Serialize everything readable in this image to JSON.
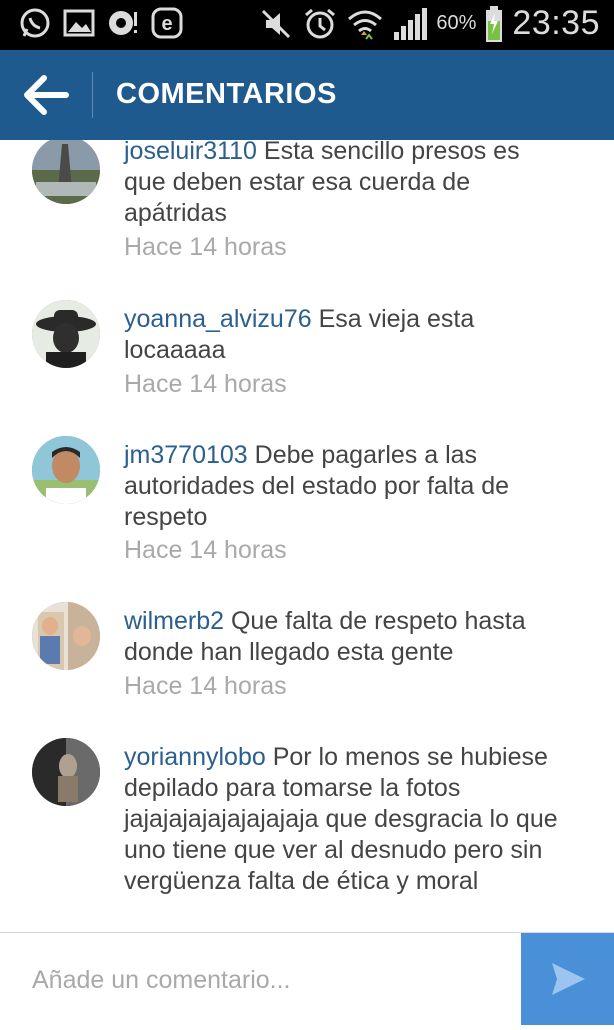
{
  "status_bar": {
    "battery": "60%",
    "time": "23:35",
    "left_icons": [
      "whatsapp-icon",
      "gallery-icon",
      "chat-icon",
      "e-app-icon"
    ],
    "right_icons": [
      "mute-icon",
      "alarm-icon",
      "wifi-icon",
      "signal-icon",
      "battery-icon"
    ]
  },
  "header": {
    "title": "COMENTARIOS",
    "back_icon": "arrow-left-icon",
    "bg_color": "#1e5a8e"
  },
  "comments": [
    {
      "username": "joseluir3110",
      "text": " Esta sencillo presos es que deben estar esa cuerda de apátridas",
      "time": "Hace 14 horas"
    },
    {
      "username": "yoanna_alvizu76",
      "text": " Esa vieja esta locaaaaa",
      "time": "Hace 14 horas"
    },
    {
      "username": "jm3770103",
      "text": " Debe pagarles a las autoridades del estado por falta de respeto",
      "time": "Hace 14 horas"
    },
    {
      "username": "wilmerb2",
      "text": " Que falta de respeto hasta donde han llegado esta gente",
      "time": "Hace 14 horas"
    },
    {
      "username": "yoriannylobo",
      "text": " Por lo menos se hubiese depilado para tomarse la fotos jajajajajajajajajaja que desgracia lo que uno tiene que ver al desnudo pero sin vergüenza falta de ética y moral",
      "time": ""
    }
  ],
  "composer": {
    "placeholder": "Añade un comentario...",
    "send_icon": "send-icon",
    "send_color": "#4a90d9"
  }
}
